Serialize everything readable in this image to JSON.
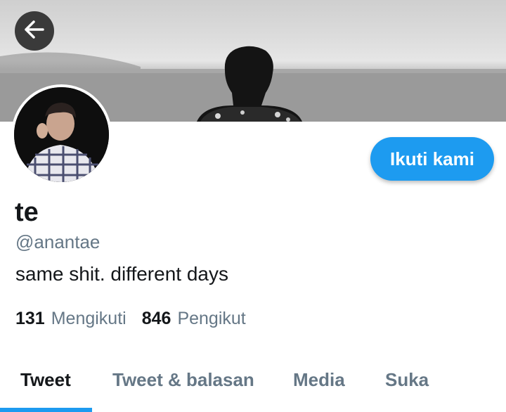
{
  "header": {
    "back_icon": "arrow-left-icon"
  },
  "profile": {
    "display_name": "te",
    "handle": "@anantae",
    "bio": "same shit. different days",
    "follow_label": "Ikuti kami",
    "stats": {
      "following_count": "131",
      "following_label": "Mengikuti",
      "followers_count": "846",
      "followers_label": "Pengikut"
    }
  },
  "tabs": [
    {
      "label": "Tweet",
      "active": true
    },
    {
      "label": "Tweet & balasan",
      "active": false
    },
    {
      "label": "Media",
      "active": false
    },
    {
      "label": "Suka",
      "active": false
    }
  ],
  "colors": {
    "accent": "#1d9bf0",
    "text_primary": "#14171a",
    "text_secondary": "#657786"
  }
}
